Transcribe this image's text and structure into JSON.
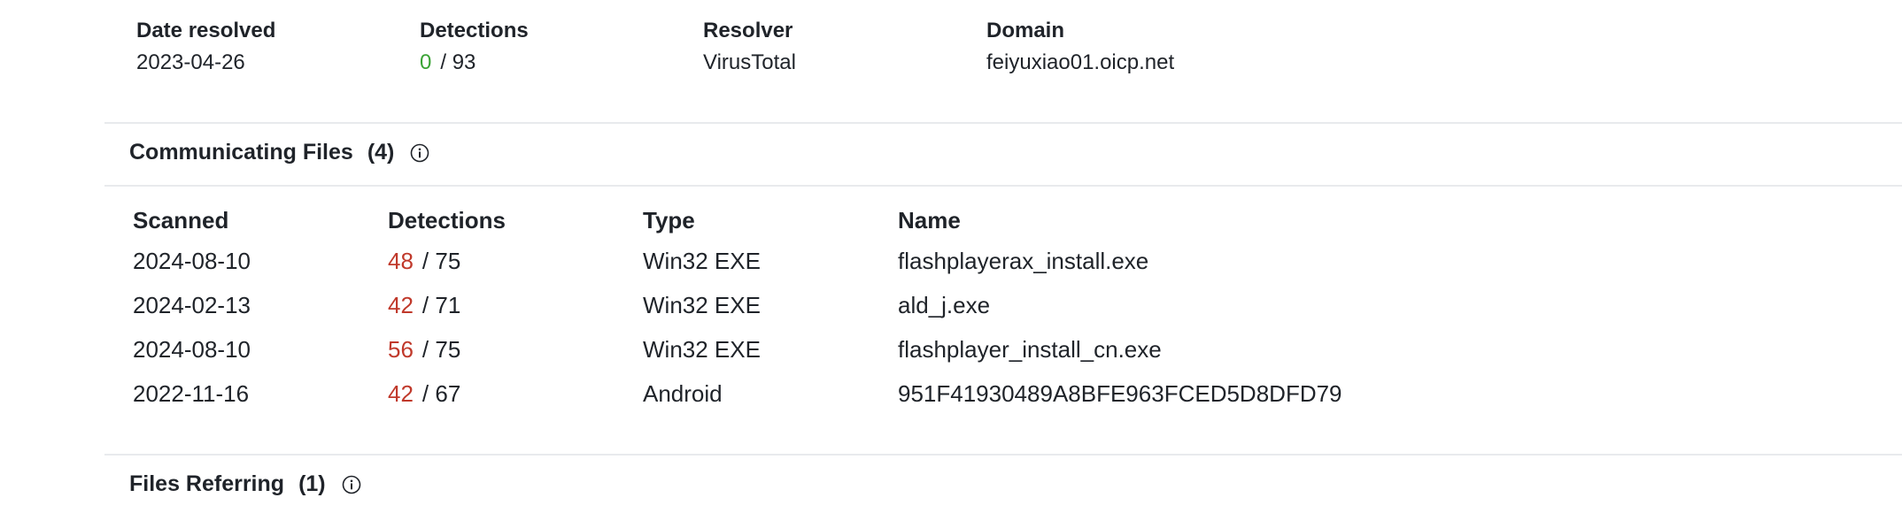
{
  "resolutions": {
    "headers": [
      "Date resolved",
      "Detections",
      "Resolver",
      "Domain"
    ],
    "row": {
      "date": "2023-04-26",
      "detections": "0",
      "total": "/ 93",
      "resolver": "VirusTotal",
      "domain": "feiyuxiao01.oicp.net"
    }
  },
  "communicating_files": {
    "title": "Communicating Files",
    "count": "(4)",
    "headers": [
      "Scanned",
      "Detections",
      "Type",
      "Name"
    ],
    "rows": [
      {
        "scanned": "2024-08-10",
        "detections": "48",
        "total": "/ 75",
        "type": "Win32 EXE",
        "name": "flashplayerax_install.exe"
      },
      {
        "scanned": "2024-02-13",
        "detections": "42",
        "total": "/ 71",
        "type": "Win32 EXE",
        "name": "ald_j.exe"
      },
      {
        "scanned": "2024-08-10",
        "detections": "56",
        "total": "/ 75",
        "type": "Win32 EXE",
        "name": "flashplayer_install_cn.exe"
      },
      {
        "scanned": "2022-11-16",
        "detections": "42",
        "total": "/ 67",
        "type": "Android",
        "name": "951F41930489A8BFE963FCED5D8DFD79"
      }
    ]
  },
  "files_referring": {
    "title": "Files Referring",
    "count": "(1)"
  },
  "icons": {
    "info": "info-icon"
  },
  "colors": {
    "malicious": "#c0392b",
    "clean": "#3aa335",
    "divider": "#e8eaed"
  }
}
